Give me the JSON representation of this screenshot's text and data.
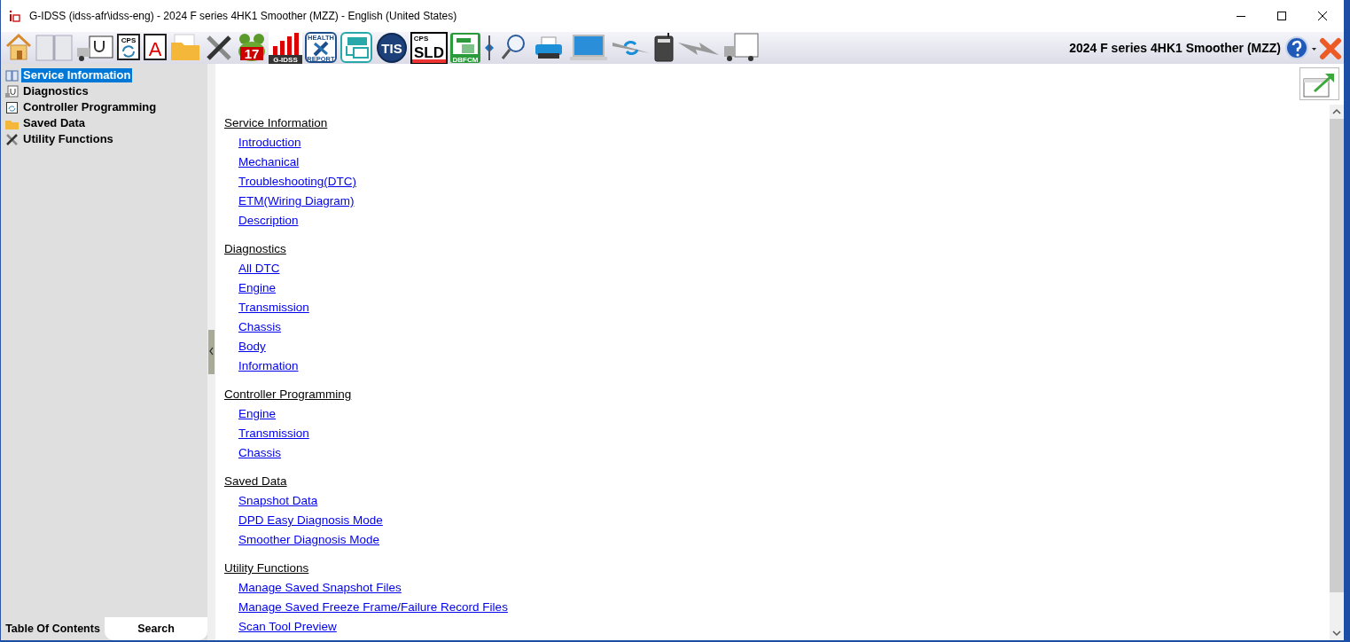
{
  "window": {
    "title": "G-IDSS (idss-afr\\idss-eng) - 2024 F series 4HK1 Smoother (MZZ) - English (United States)"
  },
  "toolbar": {
    "items": [
      {
        "kind": "home"
      },
      {
        "kind": "book"
      },
      {
        "kind": "truck-scope"
      },
      {
        "kind": "cps",
        "labels": [
          "CPS"
        ]
      },
      {
        "kind": "letter",
        "labels": [
          "A"
        ]
      },
      {
        "kind": "folder"
      },
      {
        "kind": "tools"
      },
      {
        "kind": "frog",
        "labels": [
          "17"
        ]
      },
      {
        "kind": "bars",
        "labels": [
          "G-IDSS"
        ]
      },
      {
        "kind": "report",
        "labels": [
          "HEALTH",
          "REPORT"
        ]
      },
      {
        "kind": "truck-screen"
      },
      {
        "kind": "tis",
        "labels": [
          "TIS"
        ]
      },
      {
        "kind": "sld",
        "labels": [
          "CPS",
          "SLD"
        ]
      },
      {
        "kind": "dbfcm",
        "labels": [
          "DBFCM"
        ]
      },
      {
        "kind": "splitter"
      },
      {
        "kind": "magnifier"
      },
      {
        "kind": "printer"
      },
      {
        "kind": "laptop"
      },
      {
        "kind": "arrows"
      },
      {
        "kind": "device"
      },
      {
        "kind": "bolt"
      },
      {
        "kind": "truck"
      }
    ],
    "vehicle": "2024 F series 4HK1 Smoother (MZZ)"
  },
  "sidebar": {
    "items": [
      {
        "label": "Service Information",
        "kind": "book",
        "selected": true
      },
      {
        "label": "Diagnostics",
        "kind": "diag",
        "selected": false
      },
      {
        "label": "Controller Programming",
        "kind": "cps",
        "selected": false
      },
      {
        "label": "Saved Data",
        "kind": "folder",
        "selected": false
      },
      {
        "label": "Utility Functions",
        "kind": "tools",
        "selected": false
      }
    ]
  },
  "tabs": [
    {
      "label": "Table Of Contents",
      "selected": true
    },
    {
      "label": "Search",
      "selected": false
    }
  ],
  "content": {
    "sections": [
      {
        "heading": "Service Information",
        "links": [
          "Introduction",
          "Mechanical",
          "Troubleshooting(DTC)",
          "ETM(Wiring Diagram)",
          "Description"
        ]
      },
      {
        "heading": "Diagnostics",
        "links": [
          "All DTC",
          "Engine",
          "Transmission",
          "Chassis",
          "Body",
          "Information"
        ]
      },
      {
        "heading": "Controller Programming",
        "links": [
          "Engine",
          "Transmission",
          "Chassis"
        ]
      },
      {
        "heading": "Saved Data",
        "links": [
          "Snapshot Data",
          "DPD Easy Diagnosis Mode",
          "Smoother Diagnosis Mode"
        ]
      },
      {
        "heading": "Utility Functions",
        "links": [
          "Manage Saved Snapshot Files",
          "Manage Saved Freeze Frame/Failure Record Files",
          "Scan Tool Preview"
        ]
      }
    ]
  }
}
